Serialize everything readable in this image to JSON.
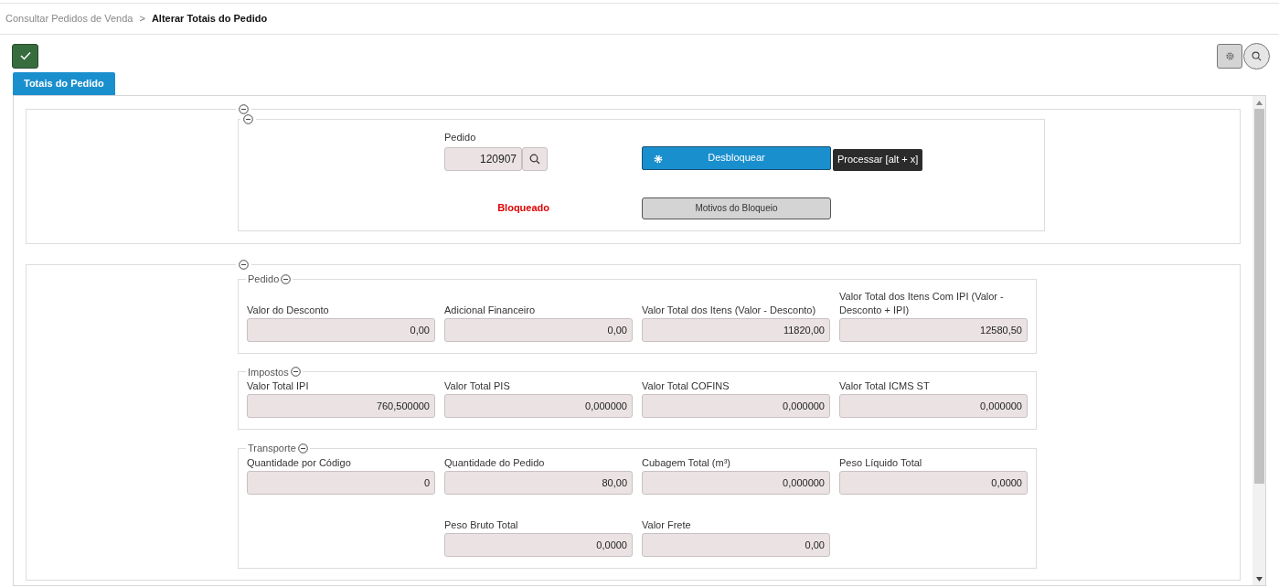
{
  "breadcrumb": [
    {
      "label": "Consultar Pedidos de Venda",
      "current": false
    },
    {
      "label": "Alterar Totais do Pedido",
      "current": true
    }
  ],
  "separator": ">",
  "tabs": [
    {
      "label": "Totais do Pedido",
      "selected": true
    }
  ],
  "order_section": {
    "order_label": "Pedido",
    "order_value": "120907",
    "status": "Bloqueado",
    "unlock_button": "Desbloquear",
    "tooltip": "Processar [alt + x]",
    "reasons_button": "Motivos do Bloqueio"
  },
  "groups": [
    {
      "title": "Pedido",
      "rows": [
        [
          {
            "label": "Valor do Desconto",
            "value": "0,00"
          },
          {
            "label": "Adicional Financeiro",
            "value": "0,00"
          },
          {
            "label": "Valor Total dos Itens (Valor - Desconto)",
            "value": "11820,00"
          },
          {
            "label": "Valor Total dos Itens Com IPI (Valor - Desconto + IPI)",
            "value": "12580,50"
          }
        ]
      ]
    },
    {
      "title": "Impostos",
      "rows": [
        [
          {
            "label": "Valor Total IPI",
            "value": "760,500000"
          },
          {
            "label": "Valor Total PIS",
            "value": "0,000000"
          },
          {
            "label": "Valor Total COFINS",
            "value": "0,000000"
          },
          {
            "label": "Valor Total ICMS ST",
            "value": "0,000000"
          }
        ]
      ]
    },
    {
      "title": "Transporte",
      "rows": [
        [
          {
            "label": "Quantidade por Código",
            "value": "0"
          },
          {
            "label": "Quantidade do Pedido",
            "value": "80,00"
          },
          {
            "label": "Cubagem Total (m³)",
            "value": "0,000000"
          },
          {
            "label": "Peso Líquido Total",
            "value": "0,0000"
          }
        ],
        [
          {
            "kind": "blank"
          },
          {
            "label": "Peso Bruto Total",
            "value": "0,0000"
          },
          {
            "label": "Valor Frete",
            "value": "0,00"
          }
        ]
      ]
    }
  ]
}
